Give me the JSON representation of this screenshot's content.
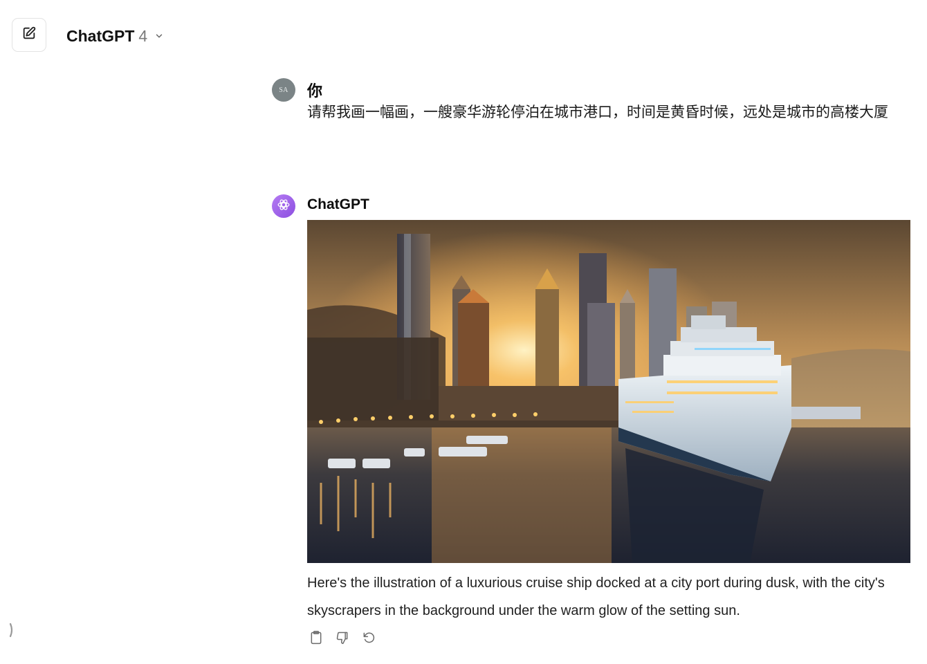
{
  "header": {
    "model_name": "ChatGPT",
    "model_version": "4"
  },
  "user_message": {
    "avatar_initials": "SA",
    "author": "你",
    "text": "请帮我画一幅画，一艘豪华游轮停泊在城市港口，时间是黄昏时候，远处是城市的高楼大厦"
  },
  "assistant_message": {
    "author": "ChatGPT",
    "image_icon": "generated-image",
    "text": "Here's the illustration of a luxurious cruise ship docked at a city port during dusk, with the city's skyscrapers in the background under the warm glow of the setting sun."
  },
  "icons": {
    "new_chat": "edit-pencil-icon",
    "model_dropdown": "chevron-down-icon",
    "copy": "clipboard-icon",
    "dislike": "thumbs-down-icon",
    "regenerate": "refresh-icon",
    "sidebar_toggle": "chevron-right-icon"
  }
}
